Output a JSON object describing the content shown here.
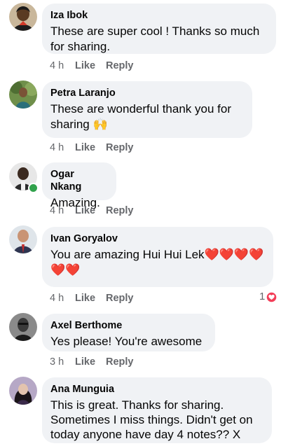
{
  "comments": [
    {
      "author": "Iza Ibok",
      "text": "These are super cool ! Thanks so much for sharing.",
      "time": "4 h",
      "like_label": "Like",
      "reply_label": "Reply"
    },
    {
      "author": "Petra Laranjo",
      "text": "These are wonderful  thank you for sharing 🙌",
      "time": "4 h",
      "like_label": "Like",
      "reply_label": "Reply"
    },
    {
      "author": "Ogar Nkang",
      "text": "Amazing.",
      "time": "4 h",
      "like_label": "Like",
      "reply_label": "Reply",
      "online": true
    },
    {
      "author": "Ivan Goryalov",
      "text": "You are amazing Hui Hui Lek",
      "hearts": "❤️❤️❤️❤️❤️❤️",
      "time": "4 h",
      "like_label": "Like",
      "reply_label": "Reply",
      "reaction_count": "1",
      "reaction_icon": "love-reaction-icon"
    },
    {
      "author": "Axel Berthome",
      "text": "Yes please! You're awesome",
      "time": "3 h",
      "like_label": "Like",
      "reply_label": "Reply"
    },
    {
      "author": "Ana Munguia",
      "text": "This is great. Thanks for sharing. Sometimes I miss things. Didn't get on today anyone have day 4 notes?? X"
    }
  ],
  "colors": {
    "bubble": "#f0f2f5",
    "meta_text": "#65676b",
    "online": "#31a24c",
    "love_reaction": "#f33e58"
  }
}
